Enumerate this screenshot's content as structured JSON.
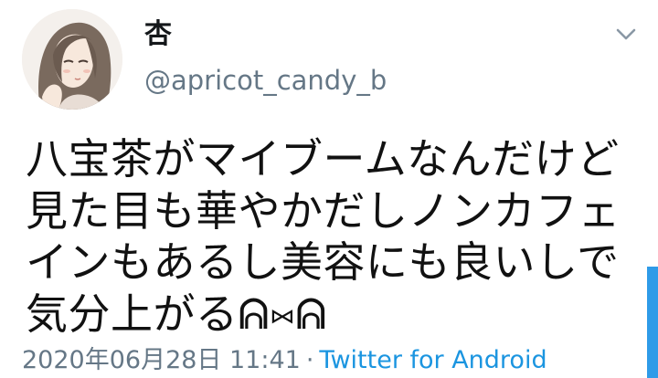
{
  "tweet": {
    "display_name": "杏",
    "handle": "@apricot_candy_b",
    "text": "八宝茶がマイブームなんだけど見た目も華やかだしノンカフェインもあるし美容にも良いしで気分上がるᕱ⑅ᕱ",
    "timestamp": "2020年06月28日 11:41",
    "separator": "·",
    "source": "Twitter for Android"
  },
  "icons": {
    "menu": "chevron-down-icon",
    "avatar": "avatar-illustration"
  },
  "colors": {
    "accent": "#1b95e0",
    "secondary_text": "#657786",
    "primary_text": "#111111",
    "scrollbar": "#2f9be8"
  }
}
